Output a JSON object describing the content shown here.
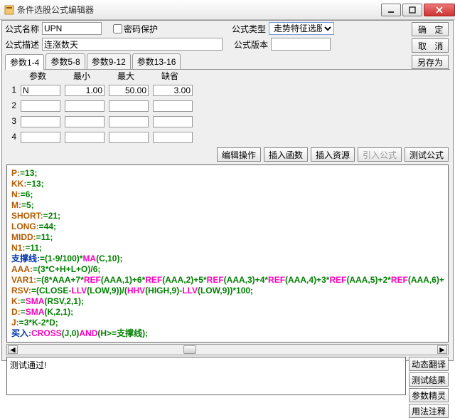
{
  "window": {
    "title": "条件选股公式编辑器"
  },
  "winbtns": {
    "min": "minimize",
    "max": "maximize",
    "close": "close"
  },
  "labels": {
    "name": "公式名称",
    "pwd": "密码保护",
    "type": "公式类型",
    "desc": "公式描述",
    "ver": "公式版本"
  },
  "fields": {
    "name": "UPN",
    "desc": "连涨数天",
    "type": "走势特征选股",
    "ver": ""
  },
  "rightbtns": {
    "ok": "确 定",
    "cancel": "取 消",
    "saveas": "另存为"
  },
  "tabs": [
    "参数1-4",
    "参数5-8",
    "参数9-12",
    "参数13-16"
  ],
  "param_headers": [
    "参数",
    "最小",
    "最大",
    "缺省"
  ],
  "params": [
    {
      "n": "1",
      "name": "N",
      "min": "1.00",
      "max": "50.00",
      "def": "3.00"
    },
    {
      "n": "2",
      "name": "",
      "min": "",
      "max": "",
      "def": ""
    },
    {
      "n": "3",
      "name": "",
      "min": "",
      "max": "",
      "def": ""
    },
    {
      "n": "4",
      "name": "",
      "min": "",
      "max": "",
      "def": ""
    }
  ],
  "midbtns": {
    "edit": "编辑操作",
    "insfn": "插入函数",
    "insres": "插入资源",
    "impf": "引入公式",
    "test": "测试公式"
  },
  "code_lines": {
    "l1a": "P:",
    "l1b": "=",
    "l1c": "13",
    "l1d": ";",
    "l2a": "KK:",
    "l2c": "13",
    "l3a": "N:",
    "l3c": "6",
    "l4a": "M:",
    "l4c": "5",
    "l5a": "SHORT:",
    "l5c": "21",
    "l6a": "LONG:",
    "l6c": "44",
    "l7a": "MIDD:",
    "l7c": "11",
    "l8a": "N1:",
    "l8c": "11",
    "l9": "支撑线:",
    "l9b": "=(",
    "l9c": "1",
    "l9d": "-",
    "l9e": "9",
    "l9f": "/",
    "l9g": "100",
    "l9h": ")*",
    "l9i": "MA",
    "l9j": "(C,",
    "l9k": "10",
    "l9l": ");",
    "l10": "AAA:",
    "l10b": "=(",
    "l10c": "3",
    "l10d": "*C+H+L+O)/",
    "l10e": "6",
    "l10f": ";",
    "l11": "VAR1:",
    "l11b": "=(",
    "l11c": "8",
    "l11d": "*AAA+",
    "l11e": "7",
    "l11f": "*",
    "l11g": "REF",
    "l11h": "(AAA,",
    "l11i": "1",
    "l11j": ")+",
    "l11k": "6",
    "l11l": "*",
    "l11m": "REF",
    "l11n": "(AAA,",
    "l11o": "2",
    "l11p": ")+",
    "l11q": "5",
    "l11r": "*",
    "l11s": "REF",
    "l11t": "(AAA,",
    "l11u": "3",
    "l11v": ")+",
    "l11w": "4",
    "l11x": "*",
    "l11y": "REF",
    "l11z": "(AAA,",
    "l11A": "4",
    "l11B": ")+",
    "l11C": "3",
    "l11D": "*",
    "l11E": "REF",
    "l11F": "(AAA,",
    "l11G": "5",
    "l11H": ")+",
    "l11I": "2",
    "l11J": "*",
    "l11K": "REF",
    "l11L": "(AAA,",
    "l11M": "6",
    "l11N": ")+",
    "l12": "RSV:",
    "l12b": "=(CLOSE-",
    "l12c": "LLV",
    "l12d": "(LOW,",
    "l12e": "9",
    "l12f": "))/(",
    "l12g": "HHV",
    "l12h": "(HIGH,",
    "l12i": "9",
    "l12j": ")-",
    "l12k": "LLV",
    "l12l": "(LOW,",
    "l12m": "9",
    "l12n": "))*",
    "l12o": "100",
    "l12p": ";",
    "l13": "K:",
    "l13b": "=",
    "l13c": "SMA",
    "l13d": "(RSV,",
    "l13e": "2",
    "l13f": ",",
    "l13g": "1",
    "l13h": ");",
    "l14": "D:",
    "l14b": "=",
    "l14c": "SMA",
    "l14d": "(K,",
    "l14e": "2",
    "l14f": ",",
    "l14g": "1",
    "l14h": ");",
    "l15": "J:",
    "l15b": "=",
    "l15c": "3",
    "l15d": "*K-",
    "l15e": "2",
    "l15f": "*D;",
    "l16": "买入:",
    "l16b": "CROSS",
    "l16c": "(J,",
    "l16d": "0",
    "l16e": ")",
    "l16f": "AND",
    "l16g": "(H>=支撑线);"
  },
  "msg": "测试通过!",
  "sidebtns": {
    "dyn": "动态翻译",
    "res": "测试结果",
    "par": "参数精灵",
    "usage": "用法注释"
  }
}
